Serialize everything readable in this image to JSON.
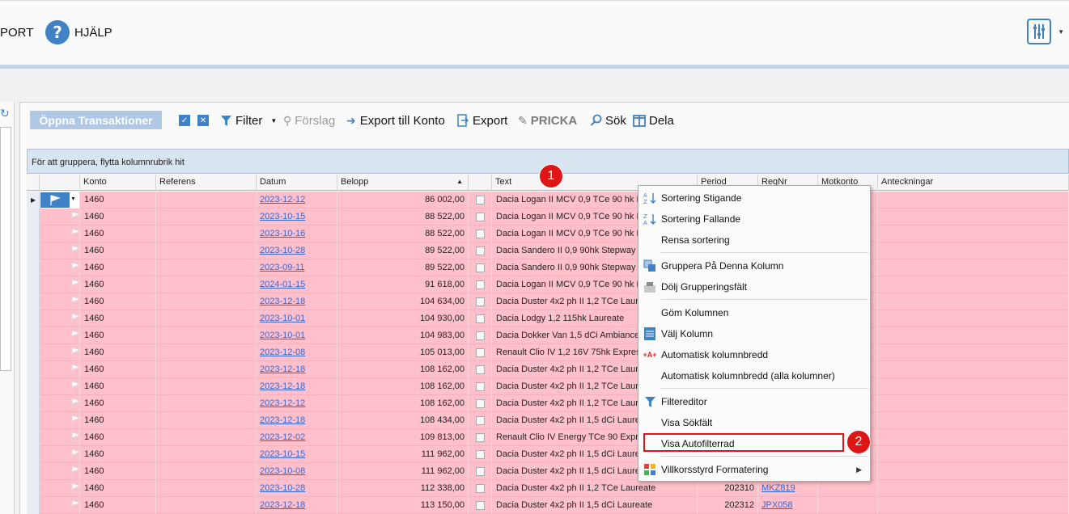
{
  "ribbon": {
    "export_partial": "PORT",
    "help_label": "HJÄLP"
  },
  "panel": {
    "title": "Öppna Transaktioner",
    "toolbar": {
      "filter": "Filter",
      "forslag": "Förslag",
      "export_konto": "Export till Konto",
      "export": "Export",
      "pricka": "PRICKA",
      "sok": "Sök",
      "dela": "Dela"
    }
  },
  "grid": {
    "group_hint": "För att gruppera, flytta kolumnrubrik hit",
    "columns": [
      "Konto",
      "Referens",
      "Datum",
      "Belopp",
      "Text",
      "Period",
      "RegNr",
      "Motkonto",
      "Anteckningar"
    ],
    "rows": [
      {
        "konto": "1460",
        "datum": "2023-12-12",
        "belopp": "86 002,00",
        "text": "Dacia Logan II MCV 0,9 TCe 90 hk La",
        "period": "",
        "regnr": ""
      },
      {
        "konto": "1460",
        "datum": "2023-10-15",
        "belopp": "88 522,00",
        "text": "Dacia Logan II MCV 0,9 TCe 90 hk La",
        "period": "",
        "regnr": ""
      },
      {
        "konto": "1460",
        "datum": "2023-10-16",
        "belopp": "88 522,00",
        "text": "Dacia Logan II MCV 0,9 TCe 90 hk La",
        "period": "",
        "regnr": ""
      },
      {
        "konto": "1460",
        "datum": "2023-10-28",
        "belopp": "89 522,00",
        "text": "Dacia Sandero II 0,9 90hk Stepway P",
        "period": "",
        "regnr": ""
      },
      {
        "konto": "1460",
        "datum": "2023-09-11",
        "belopp": "89 522,00",
        "text": "Dacia Sandero II 0,9 90hk Stepway P",
        "period": "",
        "regnr": ""
      },
      {
        "konto": "1460",
        "datum": "2024-01-15",
        "belopp": "91 618,00",
        "text": "Dacia Logan II MCV 0,9 TCe 90 hk La",
        "period": "",
        "regnr": ""
      },
      {
        "konto": "1460",
        "datum": "2023-12-18",
        "belopp": "104 634,00",
        "text": "Dacia Duster 4x2 ph II 1,2 TCe Laure",
        "period": "",
        "regnr": ""
      },
      {
        "konto": "1460",
        "datum": "2023-10-01",
        "belopp": "104 930,00",
        "text": "Dacia Lodgy 1,2 115hk Laureate",
        "period": "",
        "regnr": ""
      },
      {
        "konto": "1460",
        "datum": "2023-10-01",
        "belopp": "104 983,00",
        "text": "Dacia Dokker Van 1,5 dCi  Ambiance",
        "period": "",
        "regnr": ""
      },
      {
        "konto": "1460",
        "datum": "2023-12-08",
        "belopp": "105 013,00",
        "text": "Renault Clio IV 1,2 16V 75hk Express",
        "period": "",
        "regnr": ""
      },
      {
        "konto": "1460",
        "datum": "2023-12-18",
        "belopp": "108 162,00",
        "text": "Dacia Duster 4x2 ph II 1,2 TCe Laure",
        "period": "",
        "regnr": ""
      },
      {
        "konto": "1460",
        "datum": "2023-12-18",
        "belopp": "108 162,00",
        "text": "Dacia Duster 4x2 ph II 1,2 TCe Laure",
        "period": "",
        "regnr": ""
      },
      {
        "konto": "1460",
        "datum": "2023-12-12",
        "belopp": "108 162,00",
        "text": "Dacia Duster 4x2 ph II 1,2 TCe Laure",
        "period": "",
        "regnr": ""
      },
      {
        "konto": "1460",
        "datum": "2023-12-18",
        "belopp": "108 434,00",
        "text": "Dacia Duster 4x2 ph II 1,5 dCi Laure",
        "period": "",
        "regnr": ""
      },
      {
        "konto": "1460",
        "datum": "2023-12-02",
        "belopp": "109 813,00",
        "text": "Renault Clio IV Energy TCe 90 Expre",
        "period": "",
        "regnr": ""
      },
      {
        "konto": "1460",
        "datum": "2023-10-15",
        "belopp": "111 962,00",
        "text": "Dacia Duster 4x2 ph II 1,5 dCi Laure",
        "period": "",
        "regnr": ""
      },
      {
        "konto": "1460",
        "datum": "2023-10-08",
        "belopp": "111 962,00",
        "text": "Dacia Duster 4x2 ph II 1,5 dCi Laure",
        "period": "",
        "regnr": ""
      },
      {
        "konto": "1460",
        "datum": "2023-10-28",
        "belopp": "112 338,00",
        "text": "Dacia Duster 4x2 ph II 1,2 TCe Laureate",
        "period": "202310",
        "regnr": "MKZ819"
      },
      {
        "konto": "1460",
        "datum": "2023-12-18",
        "belopp": "113 150,00",
        "text": "Dacia Duster 4x2 ph II 1,5 dCi Laureate",
        "period": "202312",
        "regnr": "JPX058"
      }
    ]
  },
  "context_menu": {
    "items": [
      {
        "label": "Sortering Stigande",
        "icon": "sort-ascending-icon"
      },
      {
        "label": "Sortering Fallande",
        "icon": "sort-descending-icon"
      },
      {
        "label": "Rensa sortering",
        "icon": ""
      },
      {
        "label": "Gruppera På Denna Kolumn",
        "icon": "group-column-icon"
      },
      {
        "label": "Dölj Grupperingsfält",
        "icon": "hide-group-panel-icon"
      },
      {
        "label": "Göm Kolumnen",
        "icon": ""
      },
      {
        "label": "Välj Kolumn",
        "icon": "column-chooser-icon"
      },
      {
        "label": "Automatisk kolumnbredd",
        "icon": "best-fit-icon"
      },
      {
        "label": "Automatisk kolumnbredd (alla kolumner)",
        "icon": ""
      },
      {
        "label": "Filtereditor",
        "icon": "filter-editor-icon"
      },
      {
        "label": "Visa Sökfält",
        "icon": ""
      },
      {
        "label": "Visa Autofilterrad",
        "icon": ""
      },
      {
        "label": "Villkorsstyrd Formatering",
        "icon": "conditional-format-icon"
      }
    ]
  },
  "annotations": {
    "badge1": "1",
    "badge2": "2"
  },
  "colors": {
    "row_highlight": "#ffc0cb",
    "accent": "#3f82c6",
    "annotation": "#e01515"
  }
}
